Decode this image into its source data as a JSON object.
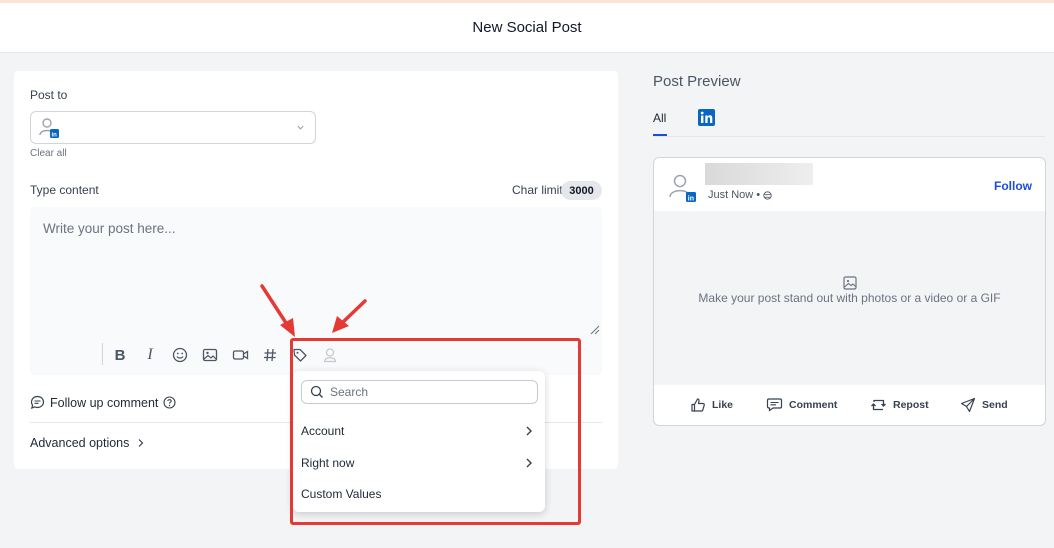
{
  "header": {
    "title": "New Social Post"
  },
  "post_to": {
    "label": "Post to",
    "clear_label": "Clear all"
  },
  "content": {
    "label": "Type content",
    "char_limit_label": "Char limit:",
    "char_limit_value": "3000",
    "placeholder": "Write your post here..."
  },
  "toolbar": {
    "icons": [
      "bold-icon",
      "italic-icon",
      "emoji-icon",
      "image-icon",
      "video-icon",
      "hashtag-icon",
      "tag-icon",
      "person-icon"
    ]
  },
  "follow_up": {
    "label": "Follow up comment"
  },
  "advanced": {
    "label": "Advanced options"
  },
  "dropdown": {
    "search_placeholder": "Search",
    "items": [
      {
        "label": "Account"
      },
      {
        "label": "Right now"
      },
      {
        "label": "Custom Values"
      }
    ]
  },
  "preview": {
    "title": "Post Preview",
    "tabs": [
      {
        "label": "All"
      },
      {
        "label": "linkedin-icon"
      }
    ],
    "time": "Just Now •",
    "follow_label": "Follow",
    "media_text": "Make your post stand out with photos or a video or a GIF",
    "actions": [
      {
        "label": "Like"
      },
      {
        "label": "Comment"
      },
      {
        "label": "Repost"
      },
      {
        "label": "Send"
      }
    ]
  },
  "colors": {
    "linkedin": "#0a66c2",
    "accent_red": "#e53935",
    "link_blue": "#1d4ed8"
  }
}
